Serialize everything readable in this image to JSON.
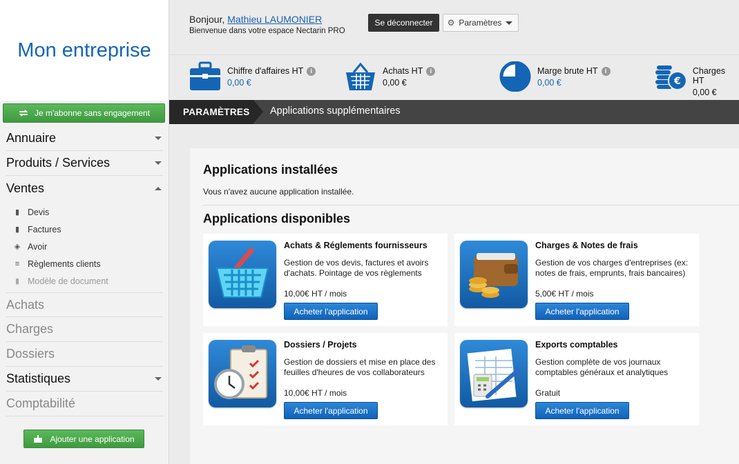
{
  "sidebar": {
    "brand": "Mon entreprise",
    "subscribe_label": "Je m'abonne sans engagement",
    "menu": [
      {
        "label": "Annuaire"
      },
      {
        "label": "Produits / Services"
      },
      {
        "label": "Ventes"
      },
      {
        "label": "Achats"
      },
      {
        "label": "Charges"
      },
      {
        "label": "Dossiers"
      },
      {
        "label": "Statistiques"
      },
      {
        "label": "Comptabilité"
      }
    ],
    "ventes_sub": [
      {
        "label": "Devis"
      },
      {
        "label": "Factures"
      },
      {
        "label": "Avoir"
      },
      {
        "label": "Règlements clients"
      },
      {
        "label": "Modèle de document"
      }
    ],
    "add_app_label": "Ajouter une application"
  },
  "header": {
    "greeting": "Bonjour,",
    "user_name": "Mathieu LAUMONIER",
    "welcome": "Bienvenue dans votre espace Nectarin PRO",
    "logout_label": "Se déconnecter",
    "settings_label": "Paramètres"
  },
  "stats": [
    {
      "label": "Chiffre d'affaires HT",
      "value": "0,00 €",
      "icon": "briefcase-icon",
      "info": "i"
    },
    {
      "label": "Achats HT",
      "value": "0,00 €",
      "icon": "basket-icon",
      "info": "i"
    },
    {
      "label": "Marge brute HT",
      "value": "0,00 €",
      "icon": "pie-chart-icon",
      "info": "i"
    },
    {
      "label": "Charges HT",
      "value": "0,00 €",
      "icon": "coins-euro-icon"
    }
  ],
  "breadcrumb": {
    "root": "PARAMÈTRES",
    "current": "Applications supplémentaires"
  },
  "main": {
    "installed_title": "Applications installées",
    "installed_message": "Vous n'avez aucune application installée.",
    "available_title": "Applications disponibles",
    "apps": [
      {
        "title": "Achats & Réglements fournisseurs",
        "description": "Gestion de vos devis, factures et avoirs d'achats. Pointage de vos règlements",
        "price": "10,00€ HT / mois",
        "button": "Acheter l'application",
        "icon": "shopping-basket-icon"
      },
      {
        "title": "Charges & Notes de frais",
        "description": "Gestion de vos charges d'entreprises (ex: notes de frais, emprunts, frais bancaires)",
        "price": "5,00€ HT / mois",
        "button": "Acheter l'application",
        "icon": "wallet-coins-icon"
      },
      {
        "title": "Dossiers / Projets",
        "description": "Gestion de dossiers et mise en place des feuilles d'heures de vos collaborateurs",
        "price": "10,00€ HT / mois",
        "button": "Acheter l'application",
        "icon": "clipboard-clock-icon"
      },
      {
        "title": "Exports comptables",
        "description": "Gestion complète de vos journaux comptables généraux et analytiques",
        "price": "Gratuit",
        "button": "Acheter l'application",
        "icon": "spreadsheet-calculator-icon"
      }
    ]
  },
  "colors": {
    "brand_blue": "#1565b5",
    "green_button": "#4cae4c",
    "blue_button": "#1a6fc6",
    "crumb_dark": "#272727"
  }
}
